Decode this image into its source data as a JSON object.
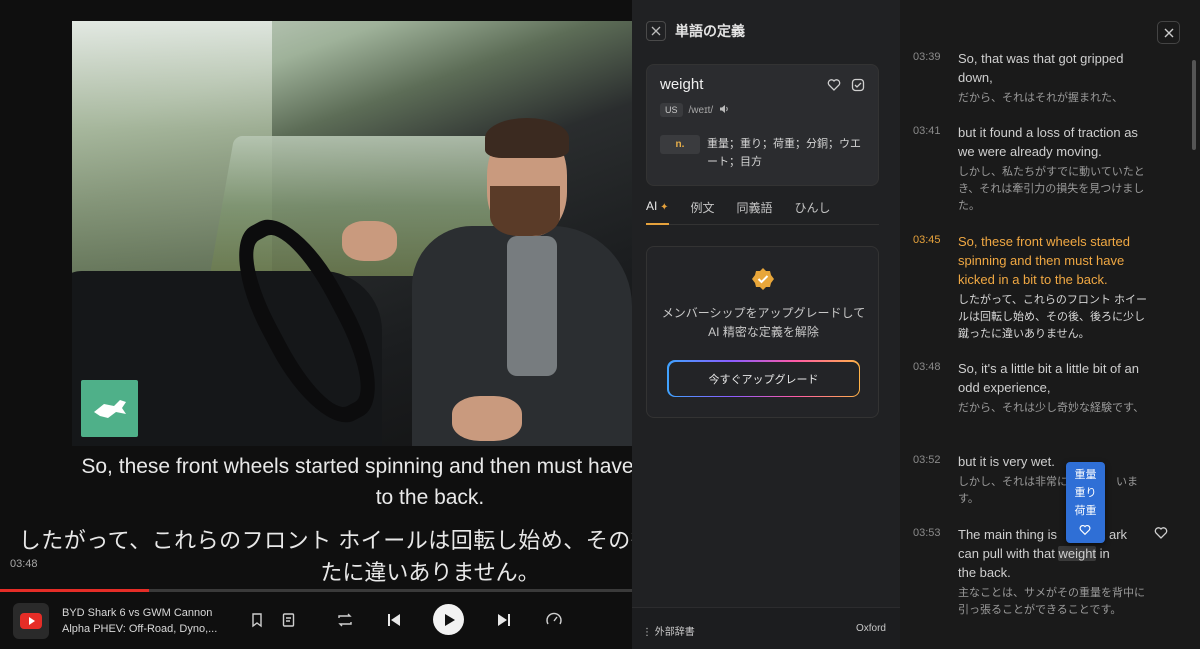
{
  "video": {
    "current_time": "03:48",
    "progress": 0.235,
    "title_line1": "BYD Shark 6 vs GWM Cannon",
    "title_line2": "Alpha PHEV: Off-Road, Dyno,...",
    "subtitle_en_line1": "So, these front wheels started spinning and then must have kicked in a bit",
    "subtitle_en_line2": "to the back.",
    "subtitle_ja_line1": "したがって、これらのフロント ホイールは回転し始め、その後、後ろに少し蹴っ",
    "subtitle_ja_line2": "たに違いありません。"
  },
  "definition": {
    "panel_title": "単語の定義",
    "word": "weight",
    "region": "US",
    "phonetic": "/weɪt/",
    "pos": "n.",
    "meaning": "重量；重り；荷重；分銅；ウエート；目方",
    "tabs": [
      {
        "label": "AI",
        "active": true
      },
      {
        "label": "例文"
      },
      {
        "label": "同義語"
      },
      {
        "label": "ひんし"
      }
    ],
    "upgrade_message": "メンバーシップをアップグレードして AI 精密な定義を解除",
    "upgrade_button": "今すぐアップグレード",
    "footer_left": "外部辞書",
    "footer_right": "Oxford"
  },
  "transcript": [
    {
      "time": "03:39",
      "en": "So, that was that got gripped down,",
      "ja": "だから、それはそれが握まれた、"
    },
    {
      "time": "03:41",
      "en": "but it found a loss of traction as we were already moving.",
      "ja": "しかし、私たちがすでに動いていたとき、それは牽引力の損失を見つけました。"
    },
    {
      "time": "03:45",
      "en": "So, these front wheels started spinning and then must have kicked in a bit to the back.",
      "ja": "したがって、これらのフロント ホイールは回転し始め、その後、後ろに少し蹴ったに違いありません。",
      "active": true
    },
    {
      "time": "03:48",
      "en": "So, it's a little bit a little bit of an odd experience,",
      "ja": "だから、それは少し奇妙な経験です、"
    },
    {
      "time": "03:52",
      "en": "but it is very wet.",
      "ja_a": "しかし、それは非常に",
      "ja_b": "います。"
    },
    {
      "time": "03:53",
      "en_a": "The main thing is",
      "en_b": "ark",
      "en_c": "can pull with that ",
      "en_hl": "weight",
      "en_d": " in",
      "en_e": "the back.",
      "ja": "主なことは、サメがその重量を背中に引っ張ることができることです。"
    }
  ],
  "popup": {
    "lines": [
      "重量",
      "重り",
      "荷重"
    ]
  },
  "colors": {
    "accent": "#e6a23c",
    "progress": "#e52d27",
    "popup": "#2f6fd6"
  }
}
